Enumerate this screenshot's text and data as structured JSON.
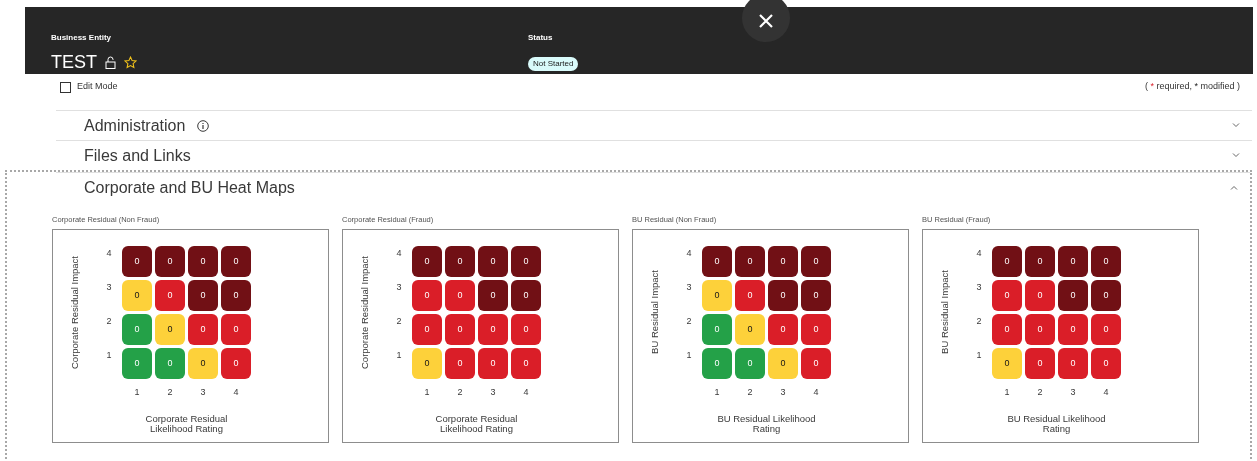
{
  "header": {
    "entity_label": "Business Entity",
    "entity_name": "TEST",
    "locked": false,
    "favorite": false,
    "status_label": "Status",
    "status": "Not Started"
  },
  "edit_mode": {
    "label": "Edit Mode",
    "checked": false
  },
  "legend": {
    "open": "(",
    "required_mark": "*",
    "required": "required,",
    "modified_mark": "*",
    "modified": "modified",
    "close": ")"
  },
  "sections": [
    {
      "title": "Administration",
      "info": true,
      "expanded": false
    },
    {
      "title": "Files and Links",
      "info": false,
      "expanded": false
    },
    {
      "title": "Corporate and BU Heat Maps",
      "info": false,
      "expanded": true
    }
  ],
  "heat_maps": [
    {
      "title": "Corporate Residual (Non Fraud)",
      "y_axis": "Corporate Residual Impact",
      "x_axis": "Corporate Residual Likelihood Rating",
      "x_labels": [
        "1",
        "2",
        "3",
        "4"
      ],
      "rows": [
        {
          "label": "4",
          "cells": [
            {
              "value": "0",
              "color": "#711015"
            },
            {
              "value": "0",
              "color": "#711015"
            },
            {
              "value": "0",
              "color": "#711015"
            },
            {
              "value": "0",
              "color": "#711015"
            }
          ]
        },
        {
          "label": "3",
          "cells": [
            {
              "value": "0",
              "color": "#fdd13a"
            },
            {
              "value": "0",
              "color": "#da1e28"
            },
            {
              "value": "0",
              "color": "#711015"
            },
            {
              "value": "0",
              "color": "#711015"
            }
          ]
        },
        {
          "label": "2",
          "cells": [
            {
              "value": "0",
              "color": "#24a148"
            },
            {
              "value": "0",
              "color": "#fdd13a"
            },
            {
              "value": "0",
              "color": "#da1e28"
            },
            {
              "value": "0",
              "color": "#da1e28"
            }
          ]
        },
        {
          "label": "1",
          "cells": [
            {
              "value": "0",
              "color": "#24a148"
            },
            {
              "value": "0",
              "color": "#24a148"
            },
            {
              "value": "0",
              "color": "#fdd13a"
            },
            {
              "value": "0",
              "color": "#da1e28"
            }
          ]
        }
      ]
    },
    {
      "title": "Corporate Residual (Fraud)",
      "y_axis": "Corporate Residual Impact",
      "x_axis": "Corporate Residual Likelihood Rating",
      "x_labels": [
        "1",
        "2",
        "3",
        "4"
      ],
      "rows": [
        {
          "label": "4",
          "cells": [
            {
              "value": "0",
              "color": "#711015"
            },
            {
              "value": "0",
              "color": "#711015"
            },
            {
              "value": "0",
              "color": "#711015"
            },
            {
              "value": "0",
              "color": "#711015"
            }
          ]
        },
        {
          "label": "3",
          "cells": [
            {
              "value": "0",
              "color": "#da1e28"
            },
            {
              "value": "0",
              "color": "#da1e28"
            },
            {
              "value": "0",
              "color": "#711015"
            },
            {
              "value": "0",
              "color": "#711015"
            }
          ]
        },
        {
          "label": "2",
          "cells": [
            {
              "value": "0",
              "color": "#da1e28"
            },
            {
              "value": "0",
              "color": "#da1e28"
            },
            {
              "value": "0",
              "color": "#da1e28"
            },
            {
              "value": "0",
              "color": "#da1e28"
            }
          ]
        },
        {
          "label": "1",
          "cells": [
            {
              "value": "0",
              "color": "#fdd13a"
            },
            {
              "value": "0",
              "color": "#da1e28"
            },
            {
              "value": "0",
              "color": "#da1e28"
            },
            {
              "value": "0",
              "color": "#da1e28"
            }
          ]
        }
      ]
    },
    {
      "title": "BU Residual (Non Fraud)",
      "y_axis": "BU Residual Impact",
      "x_axis": "BU Residual Likelihood Rating",
      "x_labels": [
        "1",
        "2",
        "3",
        "4"
      ],
      "rows": [
        {
          "label": "4",
          "cells": [
            {
              "value": "0",
              "color": "#711015"
            },
            {
              "value": "0",
              "color": "#711015"
            },
            {
              "value": "0",
              "color": "#711015"
            },
            {
              "value": "0",
              "color": "#711015"
            }
          ]
        },
        {
          "label": "3",
          "cells": [
            {
              "value": "0",
              "color": "#fdd13a"
            },
            {
              "value": "0",
              "color": "#da1e28"
            },
            {
              "value": "0",
              "color": "#711015"
            },
            {
              "value": "0",
              "color": "#711015"
            }
          ]
        },
        {
          "label": "2",
          "cells": [
            {
              "value": "0",
              "color": "#24a148"
            },
            {
              "value": "0",
              "color": "#fdd13a"
            },
            {
              "value": "0",
              "color": "#da1e28"
            },
            {
              "value": "0",
              "color": "#da1e28"
            }
          ]
        },
        {
          "label": "1",
          "cells": [
            {
              "value": "0",
              "color": "#24a148"
            },
            {
              "value": "0",
              "color": "#24a148"
            },
            {
              "value": "0",
              "color": "#fdd13a"
            },
            {
              "value": "0",
              "color": "#da1e28"
            }
          ]
        }
      ]
    },
    {
      "title": "BU Residual (Fraud)",
      "y_axis": "BU Residual Impact",
      "x_axis": "BU Residual Likelihood Rating",
      "x_labels": [
        "1",
        "2",
        "3",
        "4"
      ],
      "rows": [
        {
          "label": "4",
          "cells": [
            {
              "value": "0",
              "color": "#711015"
            },
            {
              "value": "0",
              "color": "#711015"
            },
            {
              "value": "0",
              "color": "#711015"
            },
            {
              "value": "0",
              "color": "#711015"
            }
          ]
        },
        {
          "label": "3",
          "cells": [
            {
              "value": "0",
              "color": "#da1e28"
            },
            {
              "value": "0",
              "color": "#da1e28"
            },
            {
              "value": "0",
              "color": "#711015"
            },
            {
              "value": "0",
              "color": "#711015"
            }
          ]
        },
        {
          "label": "2",
          "cells": [
            {
              "value": "0",
              "color": "#da1e28"
            },
            {
              "value": "0",
              "color": "#da1e28"
            },
            {
              "value": "0",
              "color": "#da1e28"
            },
            {
              "value": "0",
              "color": "#da1e28"
            }
          ]
        },
        {
          "label": "1",
          "cells": [
            {
              "value": "0",
              "color": "#fdd13a"
            },
            {
              "value": "0",
              "color": "#da1e28"
            },
            {
              "value": "0",
              "color": "#da1e28"
            },
            {
              "value": "0",
              "color": "#da1e28"
            }
          ]
        }
      ]
    }
  ]
}
